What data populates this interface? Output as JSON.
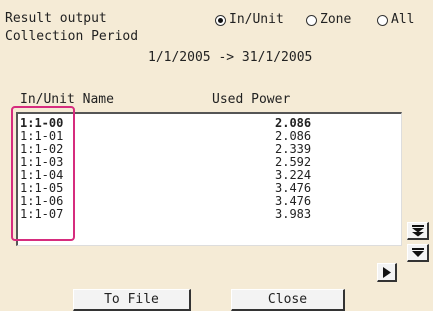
{
  "header": {
    "result_output_label": "Result output",
    "collection_period_label": "Collection Period",
    "period_range": "1/1/2005 -> 31/1/2005"
  },
  "radios": [
    {
      "label": "In/Unit",
      "selected": true
    },
    {
      "label": "Zone",
      "selected": false
    },
    {
      "label": "All",
      "selected": false
    }
  ],
  "table": {
    "columns": [
      "In/Unit Name",
      "Used Power"
    ],
    "rows": [
      {
        "name": "1:1-00",
        "power": "2.086"
      },
      {
        "name": "1:1-01",
        "power": "2.086"
      },
      {
        "name": "1:1-02",
        "power": "2.339"
      },
      {
        "name": "1:1-03",
        "power": "2.592"
      },
      {
        "name": "1:1-04",
        "power": "3.224"
      },
      {
        "name": "1:1-05",
        "power": "3.476"
      },
      {
        "name": "1:1-06",
        "power": "3.476"
      },
      {
        "name": "1:1-07",
        "power": "3.983"
      }
    ]
  },
  "buttons": {
    "to_file": "To File",
    "close": "Close"
  },
  "icons": {
    "scroll_bottom": "double-down-arrow-icon",
    "scroll_down": "down-arrow-icon",
    "next": "right-arrow-icon"
  },
  "colors": {
    "background": "#f5ebd6",
    "highlight": "#d62c7e"
  }
}
